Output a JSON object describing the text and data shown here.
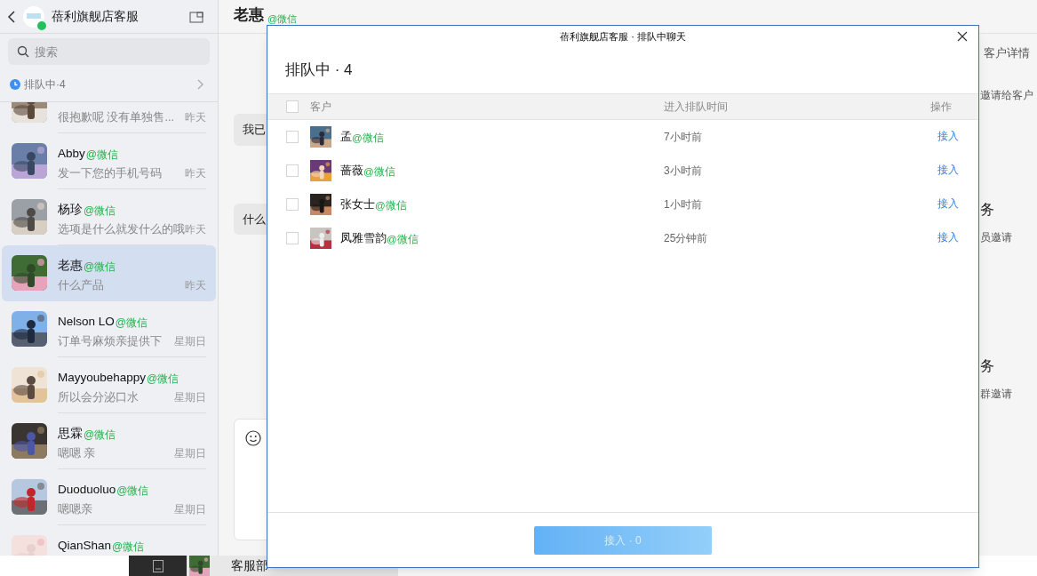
{
  "sidebar": {
    "title": "蓓利旗舰店客服",
    "search": {
      "placeholder": "搜索"
    },
    "queue": {
      "label": "排队中·4"
    },
    "conversations": [
      {
        "preview": "很抱歉呢 没有单独售...",
        "time": "昨天",
        "selected": false
      },
      {
        "name": "Abby",
        "source": "@微信",
        "preview": "发一下您的手机号码",
        "time": "昨天",
        "selected": false
      },
      {
        "name": "杨珍",
        "source": "@微信",
        "preview": "选项是什么就发什么的哦",
        "time": "昨天",
        "selected": false
      },
      {
        "name": "老惠",
        "source": "@微信",
        "preview": "什么产品",
        "time": "昨天",
        "selected": true
      },
      {
        "name": "Nelson LO",
        "source": "@微信",
        "preview": "订单号麻烦亲提供下",
        "time": "星期日",
        "selected": false
      },
      {
        "name": "Mayyoubehappy",
        "source": "@微信",
        "preview": "所以会分泌口水",
        "time": "星期日",
        "selected": false
      },
      {
        "name": "思霖",
        "source": "@微信",
        "preview": "嗯嗯 亲",
        "time": "星期日",
        "selected": false
      },
      {
        "name": "Duoduoluo",
        "source": "@微信",
        "preview": "嗯嗯亲",
        "time": "星期日",
        "selected": false
      },
      {
        "name": "QianShan",
        "source": "@微信"
      }
    ]
  },
  "chat": {
    "title": "老惠",
    "source": "@微信",
    "messages": [
      "我已",
      "什么"
    ]
  },
  "details_panel": {
    "tab": "客户详情",
    "items": [
      {
        "kind": "desc",
        "text": "邀请给客户"
      },
      {
        "kind": "heading",
        "text": "务"
      },
      {
        "kind": "desc",
        "text": "员邀请"
      },
      {
        "kind": "heading",
        "text": "务"
      },
      {
        "kind": "desc",
        "text": "群邀请"
      }
    ]
  },
  "dialog": {
    "title": "蓓利旗舰店客服 · 排队中聊天",
    "heading": "排队中 · 4",
    "select_all_checked": false,
    "columns": [
      "客户",
      "进入排队时间",
      "操作"
    ],
    "rows": [
      {
        "name": "孟",
        "source": "@微信",
        "time": "7小时前",
        "action": "接入",
        "checked": false
      },
      {
        "name": "蔷薇",
        "source": "@微信",
        "time": "3小时前",
        "action": "接入",
        "checked": false
      },
      {
        "name": "张女士",
        "source": "@微信",
        "time": "1小时前",
        "action": "接入",
        "checked": false
      },
      {
        "name": "凤雅雪韵",
        "source": "@微信",
        "time": "25分钟前",
        "action": "接入",
        "checked": false
      }
    ],
    "confirm": {
      "label": "接入 · 0",
      "disabled": true
    }
  },
  "taskbar": {
    "label": "客服部"
  }
}
